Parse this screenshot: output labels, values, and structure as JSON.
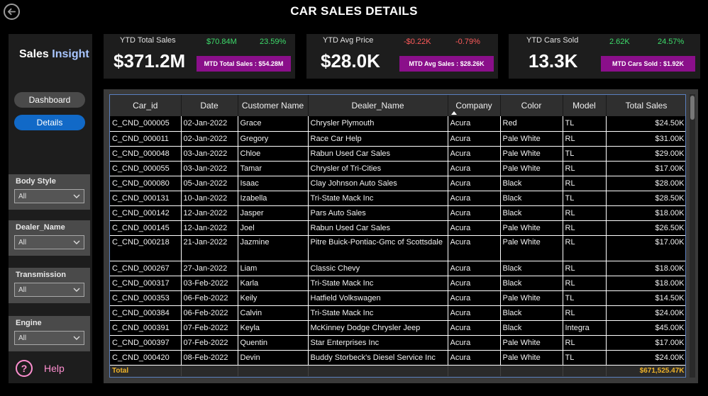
{
  "header": {
    "title": "CAR SALES DETAILS"
  },
  "sidebar": {
    "brand_1": "Sales",
    "brand_2": "Insight",
    "nav_dashboard": "Dashboard",
    "nav_details": "Details",
    "slicers": [
      {
        "label": "Body Style",
        "value": "All"
      },
      {
        "label": "Dealer_Name",
        "value": "All"
      },
      {
        "label": "Transmission",
        "value": "All"
      },
      {
        "label": "Engine",
        "value": "All"
      }
    ],
    "help_icon": "?",
    "help_label": "Help"
  },
  "kpis": [
    {
      "title": "YTD Total Sales",
      "value": "$371.2M",
      "delta_abs": "$70.84M",
      "delta_pct": "23.59%",
      "mtd": "MTD Total Sales : $54.28M"
    },
    {
      "title": "YTD Avg Price",
      "value": "$28.0K",
      "delta_abs": "-$0.22K",
      "delta_pct": "-0.79%",
      "mtd": "MTD Avg Sales : $28.26K"
    },
    {
      "title": "YTD Cars Sold",
      "value": "13.3K",
      "delta_abs": "2.62K",
      "delta_pct": "24.57%",
      "mtd": "MTD Cars Sold : $1.92K"
    }
  ],
  "table": {
    "columns": [
      "Car_id",
      "Date",
      "Customer Name",
      "Dealer_Name",
      "Company",
      "Color",
      "Model",
      "Total Sales"
    ],
    "rows": [
      [
        "C_CND_000005",
        "02-Jan-2022",
        "Grace",
        "Chrysler Plymouth",
        "Acura",
        "Red",
        "TL",
        "$24.50K"
      ],
      [
        "C_CND_000011",
        "02-Jan-2022",
        "Gregory",
        "Race Car Help",
        "Acura",
        "Pale White",
        "RL",
        "$31.00K"
      ],
      [
        "C_CND_000048",
        "03-Jan-2022",
        "Chloe",
        "Rabun Used Car Sales",
        "Acura",
        "Pale White",
        "TL",
        "$29.00K"
      ],
      [
        "C_CND_000055",
        "03-Jan-2022",
        "Tamar",
        "Chrysler of Tri-Cities",
        "Acura",
        "Pale White",
        "RL",
        "$17.00K"
      ],
      [
        "C_CND_000080",
        "05-Jan-2022",
        "Isaac",
        "Clay Johnson Auto Sales",
        "Acura",
        "Black",
        "RL",
        "$28.00K"
      ],
      [
        "C_CND_000131",
        "10-Jan-2022",
        "Izabella",
        "Tri-State Mack Inc",
        "Acura",
        "Black",
        "TL",
        "$28.50K"
      ],
      [
        "C_CND_000142",
        "12-Jan-2022",
        "Jasper",
        "Pars Auto Sales",
        "Acura",
        "Black",
        "RL",
        "$18.00K"
      ],
      [
        "C_CND_000145",
        "12-Jan-2022",
        "Joel",
        "Rabun Used Car Sales",
        "Acura",
        "Pale White",
        "RL",
        "$26.50K"
      ],
      [
        "C_CND_000218",
        "21-Jan-2022",
        "Jazmine",
        "Pitre Buick-Pontiac-Gmc of Scottsdale",
        "Acura",
        "Pale White",
        "RL",
        "$17.00K"
      ],
      [
        "C_CND_000267",
        "27-Jan-2022",
        "Liam",
        "Classic Chevy",
        "Acura",
        "Black",
        "RL",
        "$18.00K"
      ],
      [
        "C_CND_000317",
        "03-Feb-2022",
        "Karla",
        "Tri-State Mack Inc",
        "Acura",
        "Black",
        "RL",
        "$18.00K"
      ],
      [
        "C_CND_000353",
        "06-Feb-2022",
        "Keily",
        "Hatfield Volkswagen",
        "Acura",
        "Pale White",
        "TL",
        "$14.50K"
      ],
      [
        "C_CND_000384",
        "06-Feb-2022",
        "Calvin",
        "Tri-State Mack Inc",
        "Acura",
        "Black",
        "RL",
        "$24.00K"
      ],
      [
        "C_CND_000391",
        "07-Feb-2022",
        "Keyla",
        "McKinney Dodge Chrysler Jeep",
        "Acura",
        "Black",
        "Integra",
        "$45.00K"
      ],
      [
        "C_CND_000397",
        "07-Feb-2022",
        "Quentin",
        "Star Enterprises Inc",
        "Acura",
        "Pale White",
        "RL",
        "$17.00K"
      ],
      [
        "C_CND_000420",
        "08-Feb-2022",
        "Devin",
        "Buddy Storbeck's Diesel Service Inc",
        "Acura",
        "Pale White",
        "TL",
        "$24.00K"
      ]
    ],
    "total_label": "Total",
    "total_value": "$671,525.47K",
    "sorted_column": "Company"
  },
  "colors": {
    "positive": "#3ddc6b",
    "negative": "#ff5a5a",
    "mtd_badge": "#8a0f8a",
    "total": "#f0b429",
    "accent_nav": "#1169c7"
  }
}
